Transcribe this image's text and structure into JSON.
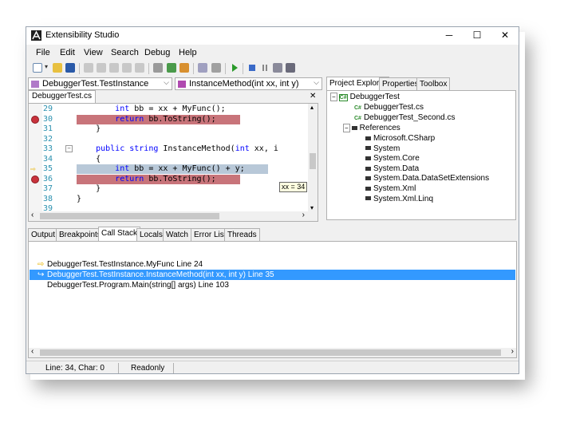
{
  "window": {
    "title": "Extensibility Studio",
    "minimize": "─",
    "maximize": "☐",
    "close": "✕"
  },
  "menu": [
    "File",
    "Edit",
    "View",
    "Search",
    "Debug",
    "Help"
  ],
  "type_combo": {
    "value": "DebuggerTest.TestInstance"
  },
  "member_combo": {
    "value": "InstanceMethod(int xx, int y)"
  },
  "document_tab": "DebuggerTest.cs",
  "code_lines": [
    {
      "num": "29",
      "text": "        int bb = xx + MyFunc();",
      "marker": "none",
      "hl": "none"
    },
    {
      "num": "30",
      "text": "        return bb.ToString();",
      "marker": "breakpoint",
      "hl": "red"
    },
    {
      "num": "31",
      "text": "    }",
      "marker": "none",
      "hl": "none"
    },
    {
      "num": "32",
      "text": "",
      "marker": "none",
      "hl": "none"
    },
    {
      "num": "33",
      "text": "    public string InstanceMethod(int xx, i",
      "marker": "collapse",
      "hl": "none"
    },
    {
      "num": "34",
      "text": "    {",
      "marker": "none",
      "hl": "none"
    },
    {
      "num": "35",
      "text": "        int bb = xx + MyFunc() + y;",
      "marker": "current",
      "hl": "blue"
    },
    {
      "num": "36",
      "text": "        return bb.ToString();",
      "marker": "breakpoint",
      "hl": "red"
    },
    {
      "num": "37",
      "text": "    }",
      "marker": "none",
      "hl": "none"
    },
    {
      "num": "38",
      "text": "}",
      "marker": "none",
      "hl": "none"
    },
    {
      "num": "39",
      "text": "",
      "marker": "none",
      "hl": "none"
    }
  ],
  "datatip": "xx = 34",
  "right_tabs": [
    "Project Explorer",
    "Properties",
    "Toolbox"
  ],
  "project_tree": {
    "root": "DebuggerTest",
    "files": [
      "DebuggerTest.cs",
      "DebuggerTest_Second.cs"
    ],
    "references_label": "References",
    "references": [
      "Microsoft.CSharp",
      "System",
      "System.Core",
      "System.Data",
      "System.Data.DataSetExtensions",
      "System.Xml",
      "System.Xml.Linq"
    ]
  },
  "bottom_tabs": [
    "Output",
    "Breakpoints",
    "Call Stack",
    "Locals",
    "Watch",
    "Error List",
    "Threads"
  ],
  "call_stack": [
    {
      "text": "DebuggerTest.TestInstance.MyFunc Line 24",
      "icon": "current-frame",
      "selected": false
    },
    {
      "text": "DebuggerTest.TestInstance.InstanceMethod(int xx, int y) Line 35",
      "icon": "return-frame",
      "selected": true
    },
    {
      "text": "DebuggerTest.Program.Main(string[] args) Line 103",
      "icon": "none",
      "selected": false
    }
  ],
  "status": {
    "position": "Line: 34, Char: 0",
    "mode": "Readonly"
  },
  "colors": {
    "breakpoint_line": "#c8747a",
    "current_line": "#b8c8d8",
    "selection": "#3399ff",
    "keyword": "#0000ff"
  }
}
